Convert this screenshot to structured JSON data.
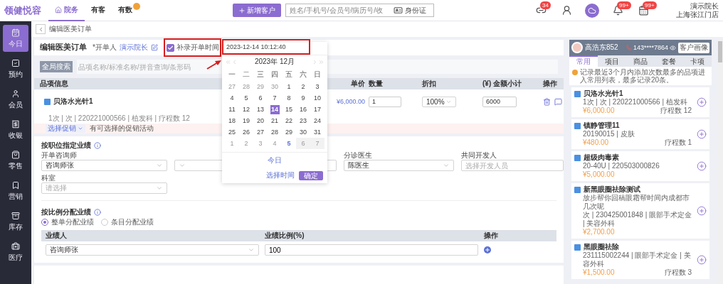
{
  "top_bar": {
    "logo": "领健悦容",
    "nav": [
      {
        "label": "院务",
        "kind": "home",
        "selected": true,
        "marked": false
      },
      {
        "label": "有客",
        "kind": "plain",
        "selected": false,
        "marked": false
      },
      {
        "label": "有数",
        "kind": "plain",
        "selected": false,
        "marked": true
      }
    ],
    "new_button": "新增客户",
    "search": {
      "placeholder": "姓名/手机号/会员号/病历号/收",
      "id_type": "身份证"
    },
    "icons": [
      {
        "kind": "link",
        "badge": "34"
      },
      {
        "kind": "user"
      },
      {
        "kind": "cloud"
      },
      {
        "kind": "bell",
        "badge": "99+"
      },
      {
        "kind": "calendar",
        "badge": "99+"
      }
    ],
    "user": {
      "name": "演示院长",
      "store": "上海张江门店"
    }
  },
  "sidebar": [
    {
      "label": "今日",
      "kind": "today",
      "selected": true
    },
    {
      "label": "预约",
      "kind": "appointment",
      "selected": false
    },
    {
      "label": "会员",
      "kind": "member",
      "selected": false
    },
    {
      "label": "收银",
      "kind": "cashier",
      "selected": false
    },
    {
      "label": "零售",
      "kind": "retail",
      "selected": false
    },
    {
      "label": "营销",
      "kind": "marketing",
      "selected": false
    },
    {
      "label": "库存",
      "kind": "inventory",
      "selected": false
    },
    {
      "label": "医疗",
      "kind": "medical",
      "selected": false
    }
  ],
  "breadcrumb": "编辑医美订单",
  "order_header": {
    "title": "编辑医美订单",
    "opener_label": "*开单人",
    "opener": "演示院长",
    "backfill": {
      "label": "补录开单时间",
      "checked": true,
      "highlighted": true
    }
  },
  "calendar": {
    "value": "2023-12-14 10:12:40",
    "highlighted": true,
    "title": "2023年 12月",
    "weekdays": [
      "一",
      "二",
      "三",
      "四",
      "五",
      "六",
      "日"
    ],
    "days": [
      {
        "label": "27",
        "kind": "outside",
        "selected": false
      },
      {
        "label": "28",
        "kind": "outside",
        "selected": false
      },
      {
        "label": "29",
        "kind": "outside",
        "selected": false
      },
      {
        "label": "30",
        "kind": "outside",
        "selected": false
      },
      {
        "label": "1",
        "kind": "month",
        "selected": false
      },
      {
        "label": "2",
        "kind": "month",
        "selected": false
      },
      {
        "label": "3",
        "kind": "month",
        "selected": false
      },
      {
        "label": "4",
        "kind": "month",
        "selected": false
      },
      {
        "label": "5",
        "kind": "month",
        "selected": false
      },
      {
        "label": "6",
        "kind": "month",
        "selected": false
      },
      {
        "label": "7",
        "kind": "month",
        "selected": false
      },
      {
        "label": "8",
        "kind": "month",
        "selected": false
      },
      {
        "label": "9",
        "kind": "month",
        "selected": false
      },
      {
        "label": "10",
        "kind": "month",
        "selected": false
      },
      {
        "label": "11",
        "kind": "month",
        "selected": false
      },
      {
        "label": "12",
        "kind": "month",
        "selected": false
      },
      {
        "label": "13",
        "kind": "month",
        "selected": false
      },
      {
        "label": "14",
        "kind": "month",
        "selected": true
      },
      {
        "label": "15",
        "kind": "month",
        "selected": false
      },
      {
        "label": "16",
        "kind": "month",
        "selected": false
      },
      {
        "label": "17",
        "kind": "month",
        "selected": false
      },
      {
        "label": "18",
        "kind": "month",
        "selected": false
      },
      {
        "label": "19",
        "kind": "month",
        "selected": false
      },
      {
        "label": "20",
        "kind": "month",
        "selected": false
      },
      {
        "label": "21",
        "kind": "month",
        "selected": false
      },
      {
        "label": "22",
        "kind": "month",
        "selected": false
      },
      {
        "label": "23",
        "kind": "month",
        "selected": false
      },
      {
        "label": "24",
        "kind": "month",
        "selected": false
      },
      {
        "label": "25",
        "kind": "month",
        "selected": false
      },
      {
        "label": "26",
        "kind": "month",
        "selected": false
      },
      {
        "label": "27",
        "kind": "month",
        "selected": false
      },
      {
        "label": "28",
        "kind": "month",
        "selected": false
      },
      {
        "label": "29",
        "kind": "month",
        "selected": false
      },
      {
        "label": "30",
        "kind": "month",
        "selected": false
      },
      {
        "label": "31",
        "kind": "month",
        "selected": false
      },
      {
        "label": "1",
        "kind": "outside",
        "selected": false
      },
      {
        "label": "2",
        "kind": "outside",
        "selected": false
      },
      {
        "label": "3",
        "kind": "outside",
        "selected": false
      },
      {
        "label": "4",
        "kind": "outside",
        "selected": false
      },
      {
        "label": "5",
        "kind": "today",
        "selected": false
      },
      {
        "label": "6",
        "kind": "disabled",
        "selected": false
      },
      {
        "label": "7",
        "kind": "disabled",
        "selected": false
      }
    ],
    "today_link": "今日",
    "time_link": "选择时间",
    "confirm_button": "确定"
  },
  "search": {
    "tag": "全局搜索",
    "placeholder": "品项名称/标准名称/拼音查询/条形码"
  },
  "items_table": {
    "columns": [
      "品项信息",
      "单价",
      "数量",
      "折扣",
      "(¥) 金额小计",
      "操作"
    ],
    "rows": [
      {
        "name": "贝洛水光针1",
        "price": "¥6,000.00",
        "quantity": "1",
        "discount": "100%",
        "subtotal": "6000",
        "details": "1次 | 次 | 220221000566 | 植发科 | 疗程数 12",
        "promo_button": "选择促销",
        "promo_note": "有可选择的促销活动"
      }
    ]
  },
  "performance_by_role": {
    "title": "按职位指定业绩",
    "fields": [
      {
        "kind": "select",
        "label": "开单咨询师",
        "value": "咨询师张"
      },
      {
        "kind": "select"
      },
      {
        "kind": "select",
        "label": "分诊医生",
        "value": "陈医生"
      },
      {
        "kind": "input",
        "label": "共同开发人",
        "placeholder": "选择开发人员"
      },
      {
        "kind": "select",
        "label": "科室",
        "placeholder": "请选择"
      }
    ]
  },
  "performance_ratio": {
    "title": "按比例分配业绩",
    "options": [
      {
        "label": "整单分配业绩",
        "selected": true
      },
      {
        "label": "条目分配业绩",
        "selected": false
      }
    ],
    "columns": [
      "业绩人",
      "业绩比例(%)",
      "操作"
    ],
    "rows": [
      {
        "person": "咨询师张",
        "ratio": "100"
      }
    ]
  },
  "right_panel": {
    "customer": {
      "name": "高浩东852",
      "phone": "143****7864",
      "profile_button": "客户画像"
    },
    "tabs": [
      {
        "label": "常用",
        "selected": true
      },
      {
        "label": "项目",
        "selected": false
      },
      {
        "label": "商品",
        "selected": false
      },
      {
        "label": "套餐",
        "selected": false
      },
      {
        "label": "卡项",
        "selected": false
      }
    ],
    "notice": "记录最近3个月内添加次数最多的品项进入常用列表，最多记录20条。",
    "items": [
      {
        "name": "贝洛水光针1",
        "details": "1次 | 次 | 220221000566 | 植发科",
        "price": "¥6,000.00",
        "count": "疗程数 12"
      },
      {
        "name": "镇静管理11",
        "details": "20190015 | 皮肤",
        "price": "¥480.00",
        "count": "疗程数 1"
      },
      {
        "name": "超级肉毒素",
        "details": "20-40U | 220503000826",
        "price": "¥5,000.00"
      },
      {
        "name": "新黑眼圈祛除测试",
        "description": "放步帮你回稿眼霜帮时间内成都市几次呢",
        "details": "次 | 230425001848 | 眼部手术定金 | 美容外科",
        "price": "¥2,700.00"
      },
      {
        "name": "黑眼圈祛除",
        "details": "231115002244 | 眼部手术定金 | 美容外科",
        "price": "¥1,500.00",
        "count": "疗程数 3"
      }
    ]
  }
}
